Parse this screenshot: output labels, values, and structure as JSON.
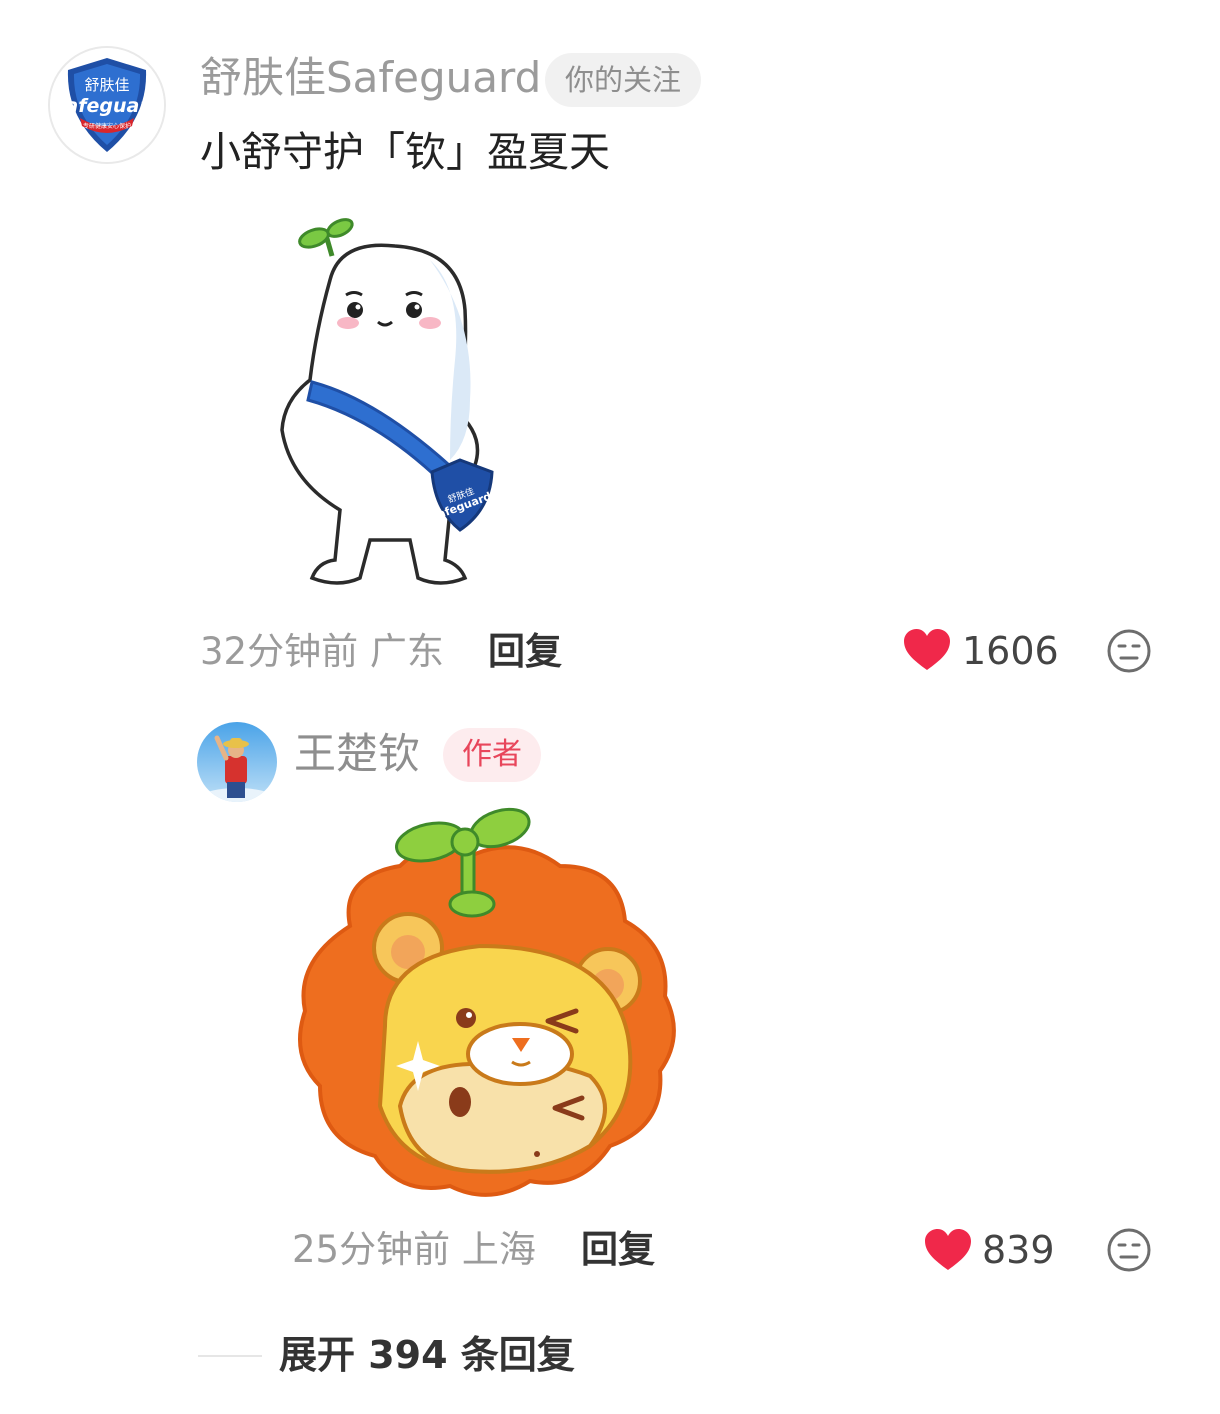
{
  "comments": [
    {
      "avatar": "safeguard-logo",
      "avatar_text": {
        "top": "舒肤佳",
        "brand": "Safeguard",
        "tagline": "专研健康安心保护"
      },
      "username": "舒肤佳Safeguard",
      "badge": "你的关注",
      "text": "小舒守护「钦」盈夏天",
      "sticker": "safeguard-mascot-sticker",
      "sticker_text": {
        "top": "舒肤佳",
        "brand": "Safeguard"
      },
      "meta": "32分钟前 广东",
      "reply_label": "回复",
      "likes": "1606",
      "icons": {
        "like": "heart-icon",
        "react": "neutral-face-icon"
      }
    },
    {
      "avatar": "user-photo",
      "username": "王楚钦",
      "badge": "作者",
      "sticker": "lion-mascot-sticker",
      "meta": "25分钟前 上海",
      "reply_label": "回复",
      "likes": "839",
      "icons": {
        "like": "heart-icon",
        "react": "neutral-face-icon"
      }
    }
  ],
  "expand": {
    "label": "展开 394 条回复"
  },
  "colors": {
    "heart": "#f0284a",
    "author_badge_bg": "#fdecee",
    "author_badge_text": "#e8465b",
    "muted_text": "#9b9b9b"
  }
}
